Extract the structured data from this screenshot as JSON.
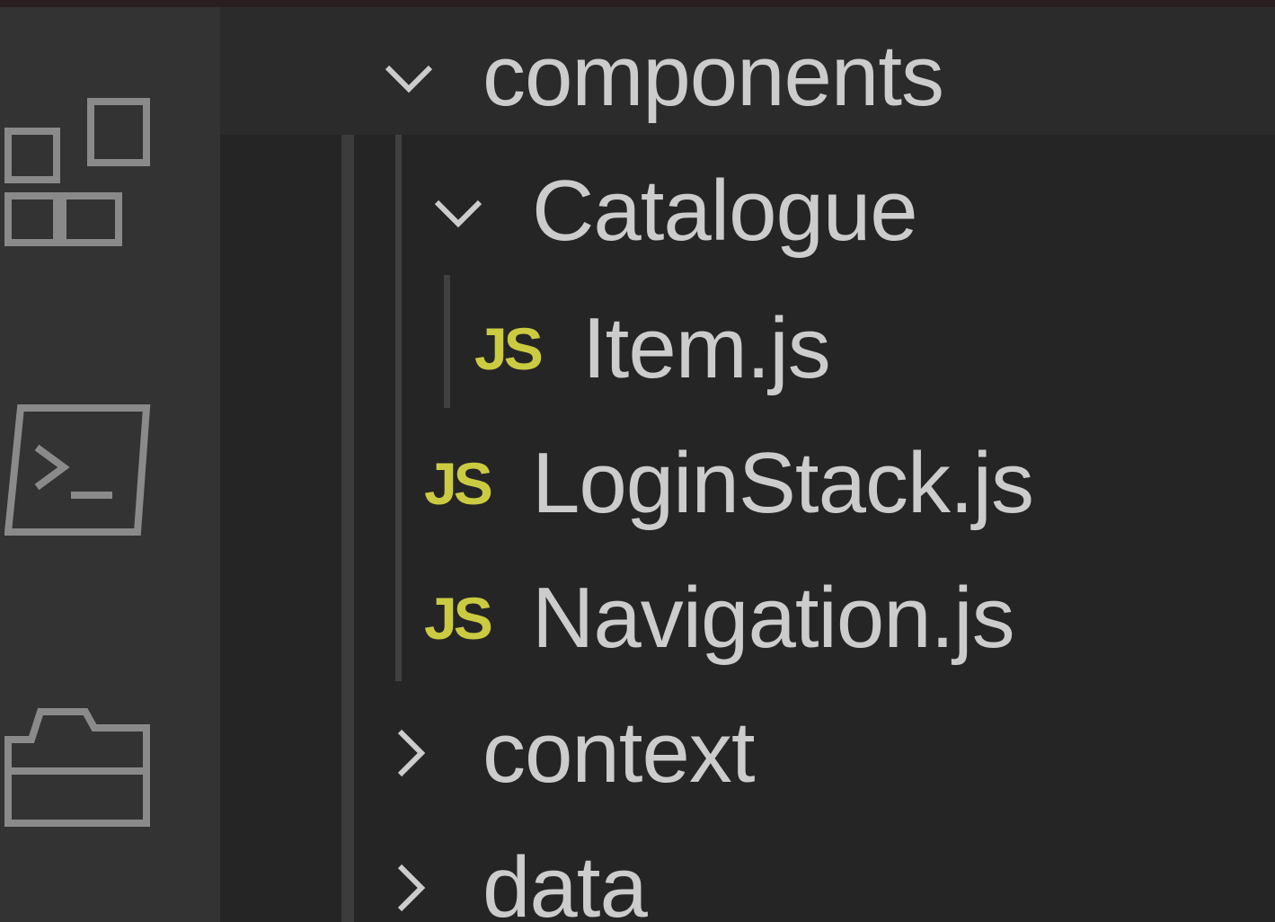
{
  "explorer": {
    "items": [
      {
        "label": "components",
        "type": "folder",
        "expanded": true
      },
      {
        "label": "Catalogue",
        "type": "folder",
        "expanded": true
      },
      {
        "label": "Item.js",
        "type": "file",
        "badge": "JS"
      },
      {
        "label": "LoginStack.js",
        "type": "file",
        "badge": "JS"
      },
      {
        "label": "Navigation.js",
        "type": "file",
        "badge": "JS"
      },
      {
        "label": "context",
        "type": "folder",
        "expanded": false
      },
      {
        "label": "data",
        "type": "folder",
        "expanded": false
      }
    ]
  },
  "activity_bar": {
    "icons": [
      "extensions-icon",
      "terminal-icon",
      "folder-icon"
    ]
  },
  "colors": {
    "background": "#252526",
    "activity_bar": "#333333",
    "text": "#cccccc",
    "js_badge": "#cbcb41"
  }
}
